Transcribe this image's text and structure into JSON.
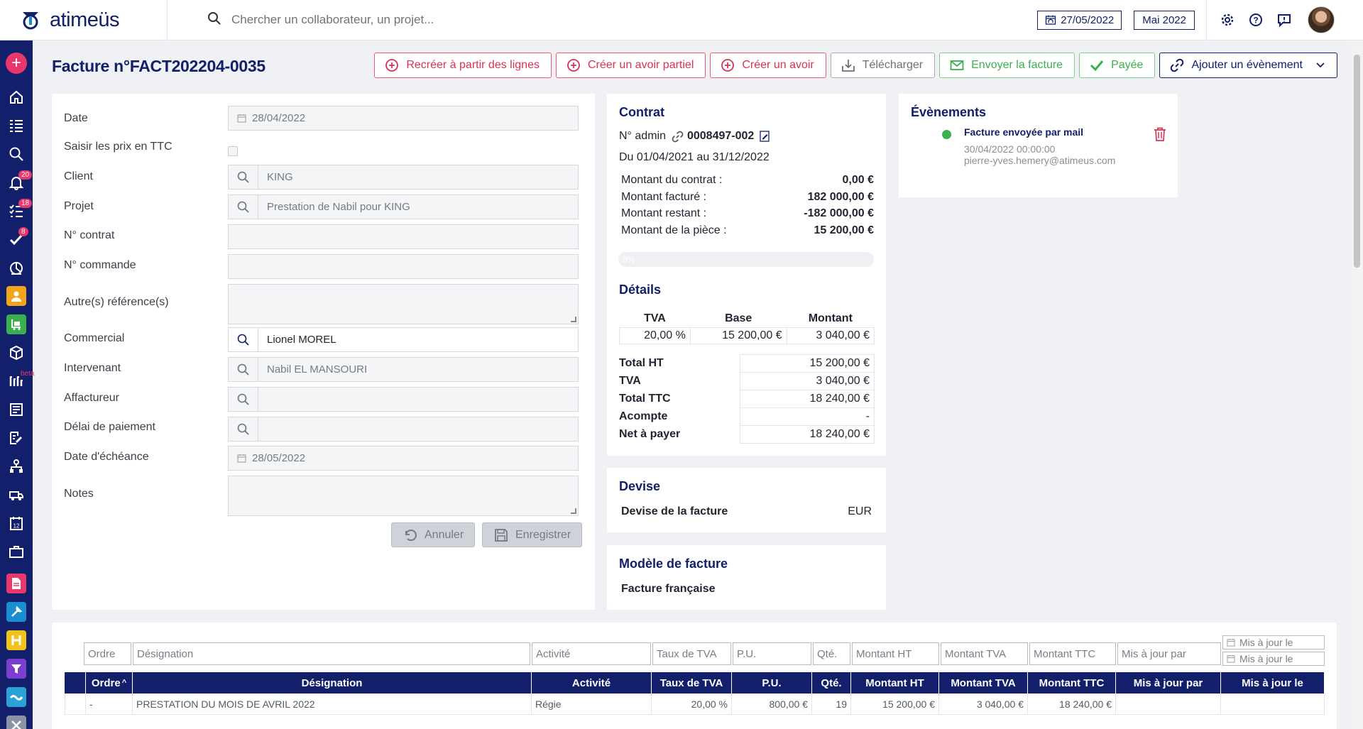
{
  "app": {
    "logo_text": "atimeüs",
    "search_placeholder": "Chercher un collaborateur, un projet...",
    "date": "27/05/2022",
    "month": "Mai 2022"
  },
  "sidebar": {
    "badges": {
      "notifications": "20",
      "tasks": "18",
      "validations": "8"
    },
    "beta": "beta"
  },
  "page": {
    "title": "Facture n°FACT202204-0035"
  },
  "actions": {
    "recreate": "Recréer à partir des lignes",
    "partial_credit": "Créer un avoir partiel",
    "credit": "Créer un avoir",
    "download": "Télécharger",
    "send": "Envoyer la facture",
    "paid": "Payée",
    "add_event": "Ajouter un évènement"
  },
  "form": {
    "date_label": "Date",
    "date_value": "28/04/2022",
    "ttc_label": "Saisir les prix en TTC",
    "client_label": "Client",
    "client_value": "KING",
    "project_label": "Projet",
    "project_value": "Prestation de Nabil pour KING",
    "contract_label": "N° contrat",
    "order_label": "N° commande",
    "other_ref_label": "Autre(s) référence(s)",
    "sales_label": "Commercial",
    "sales_value": "Lionel MOREL",
    "consultant_label": "Intervenant",
    "consultant_value": "Nabil EL MANSOURI",
    "factor_label": "Affactureur",
    "payment_delay_label": "Délai de paiement",
    "due_date_label": "Date d'échéance",
    "due_date_value": "28/05/2022",
    "notes_label": "Notes",
    "cancel": "Annuler",
    "save": "Enregistrer"
  },
  "contract": {
    "heading": "Contrat",
    "admin_label": "N° admin",
    "admin_value": "0008497-002",
    "period": "Du 01/04/2021 au 31/12/2022",
    "rows": [
      {
        "label": "Montant du contrat :",
        "value": "0,00 €"
      },
      {
        "label": "Montant facturé :",
        "value": "182 000,00 €"
      },
      {
        "label": "Montant restant :",
        "value": "-182 000,00 €"
      },
      {
        "label": "Montant de la pièce :",
        "value": "15 200,00 €"
      }
    ],
    "progress_label": "0%",
    "progress": 0
  },
  "details": {
    "heading": "Détails",
    "vat_headers": [
      "TVA",
      "Base",
      "Montant"
    ],
    "vat_row": [
      "20,00 %",
      "15 200,00 €",
      "3 040,00 €"
    ],
    "totals": [
      {
        "label": "Total HT",
        "value": "15 200,00 €"
      },
      {
        "label": "TVA",
        "value": "3 040,00 €"
      },
      {
        "label": "Total TTC",
        "value": "18 240,00 €"
      },
      {
        "label": "Acompte",
        "value": "-"
      },
      {
        "label": "Net à payer",
        "value": "18 240,00 €"
      }
    ]
  },
  "currency": {
    "heading": "Devise",
    "label": "Devise de la facture",
    "value": "EUR"
  },
  "template": {
    "heading": "Modèle de facture",
    "value": "Facture française"
  },
  "events": {
    "heading": "Évènements",
    "items": [
      {
        "title": "Facture envoyée par mail",
        "date": "30/04/2022 00:00:00",
        "user": "pierre-yves.hemery@atimeus.com"
      }
    ]
  },
  "lines": {
    "filter_placeholders": [
      "Ordre",
      "Désignation",
      "Activité",
      "Taux de TVA",
      "P.U.",
      "Qté.",
      "Montant HT",
      "Montant TVA",
      "Montant TTC",
      "Mis à jour par",
      "Mis à jour le",
      "Mis à jour le"
    ],
    "headers": [
      "Ordre",
      "Désignation",
      "Activité",
      "Taux de TVA",
      "P.U.",
      "Qté.",
      "Montant HT",
      "Montant TVA",
      "Montant TTC",
      "Mis à jour par",
      "Mis à jour le"
    ],
    "rows": [
      [
        "-",
        "PRESTATION DU MOIS DE AVRIL 2022",
        "Régie",
        "20,00 %",
        "800,00 €",
        "19",
        "15 200,00 €",
        "3 040,00 €",
        "18 240,00 €",
        "",
        ""
      ]
    ]
  },
  "colors": {
    "navy": "#12206b",
    "red": "#d93355",
    "green": "#3bb04f",
    "pink": "#e8386b"
  }
}
